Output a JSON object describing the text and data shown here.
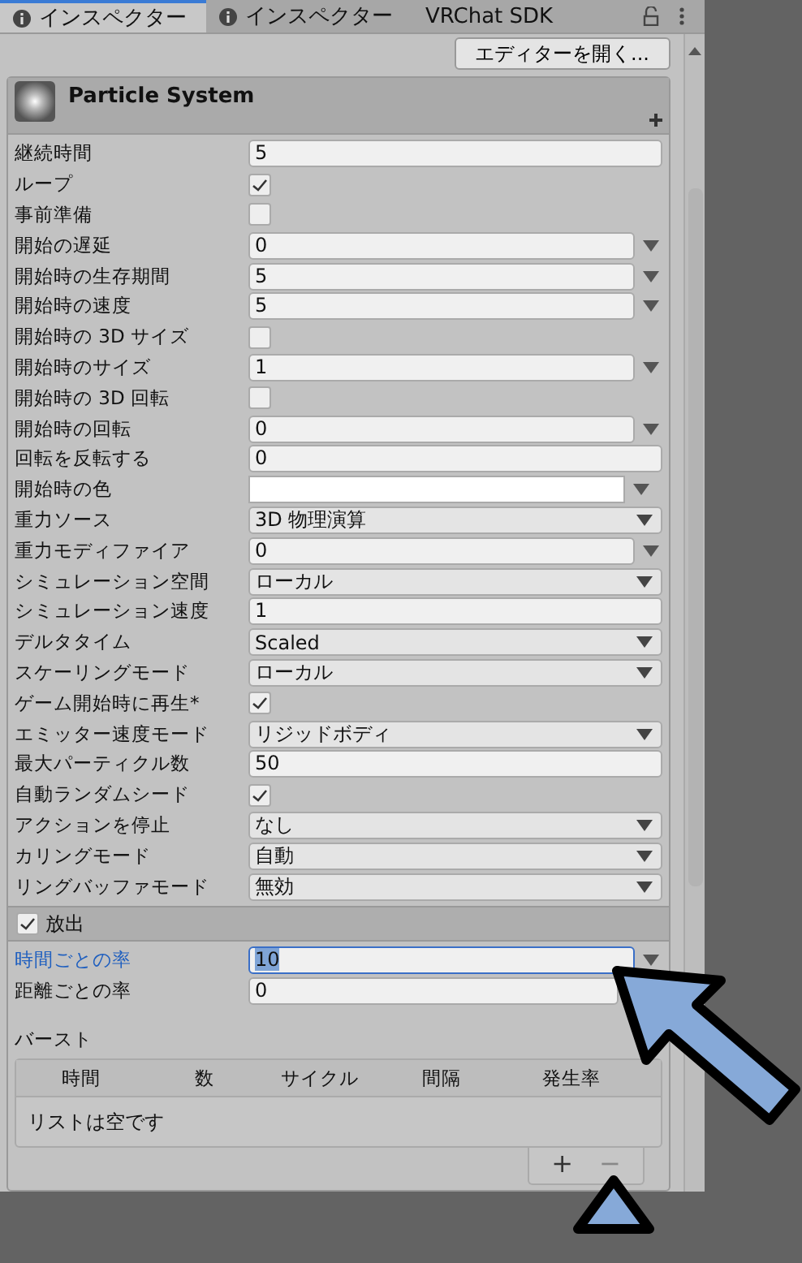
{
  "tabs": [
    {
      "label": "インスペクター",
      "kind": "info",
      "selected": true
    },
    {
      "label": "インスペクター",
      "kind": "info",
      "selected": false
    },
    {
      "label": "VRChat SDK",
      "kind": "plain",
      "selected": false
    }
  ],
  "open_editor_button": "エディターを開く...",
  "component": {
    "title": "Particle System",
    "rows": [
      {
        "label": "継続時間",
        "kind": "text",
        "value": "5"
      },
      {
        "label": "ループ",
        "kind": "checkbox",
        "checked": true
      },
      {
        "label": "事前準備",
        "kind": "checkbox",
        "checked": false
      },
      {
        "label": "開始の遅延",
        "kind": "curve",
        "value": "0"
      },
      {
        "label": "開始時の生存期間",
        "kind": "curve",
        "value": "5"
      },
      {
        "label": "開始時の速度",
        "kind": "curve",
        "value": "5"
      },
      {
        "label": "開始時の 3D サイズ",
        "kind": "checkbox",
        "checked": false
      },
      {
        "label": "開始時のサイズ",
        "kind": "curve",
        "value": "1"
      },
      {
        "label": "開始時の 3D 回転",
        "kind": "checkbox",
        "checked": false
      },
      {
        "label": "開始時の回転",
        "kind": "curve",
        "value": "0"
      },
      {
        "label": "回転を反転する",
        "kind": "text",
        "value": "0"
      },
      {
        "label": "開始時の色",
        "kind": "color",
        "color": "#ffffff"
      },
      {
        "label": "重力ソース",
        "kind": "dropdown",
        "value": "3D 物理演算"
      },
      {
        "label": "重力モディファイア",
        "kind": "curve",
        "value": "0"
      },
      {
        "label": "シミュレーション空間",
        "kind": "dropdown",
        "value": "ローカル"
      },
      {
        "label": "シミュレーション速度",
        "kind": "text",
        "value": "1"
      },
      {
        "label": "デルタタイム",
        "kind": "dropdown",
        "value": "Scaled"
      },
      {
        "label": "スケーリングモード",
        "kind": "dropdown",
        "value": "ローカル"
      },
      {
        "label": "ゲーム開始時に再生*",
        "kind": "checkbox",
        "checked": true
      },
      {
        "label": "エミッター速度モード",
        "kind": "dropdown",
        "value": "リジッドボディ"
      },
      {
        "label": "最大パーティクル数",
        "kind": "text",
        "value": "50"
      },
      {
        "label": "自動ランダムシード",
        "kind": "checkbox",
        "checked": true
      },
      {
        "label": "アクションを停止",
        "kind": "dropdown",
        "value": "なし"
      },
      {
        "label": "カリングモード",
        "kind": "dropdown",
        "value": "自動"
      },
      {
        "label": "リングバッファモード",
        "kind": "dropdown",
        "value": "無効"
      }
    ]
  },
  "emission": {
    "title": "放出",
    "checked": true,
    "rows": [
      {
        "label": "時間ごとの率",
        "kind": "curve",
        "value": "10",
        "focused": true
      },
      {
        "label": "距離ごとの率",
        "kind": "text",
        "value": "0",
        "focused": false
      }
    ],
    "bursts": {
      "label": "バースト",
      "columns": [
        "時間",
        "数",
        "サイクル",
        "間隔",
        "発生率"
      ],
      "empty_text": "リストは空です",
      "buttons": [
        "+",
        "−"
      ]
    }
  }
}
